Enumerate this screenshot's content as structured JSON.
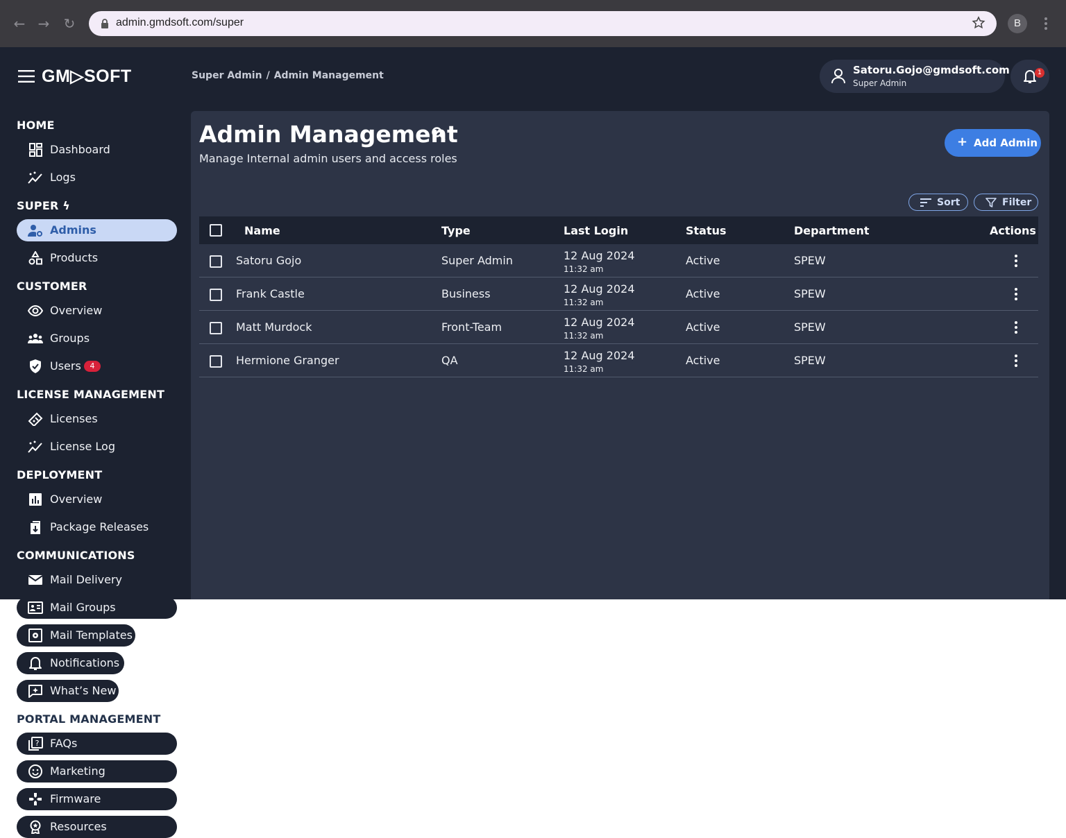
{
  "browser": {
    "url": "admin.gmdsoft.com/super",
    "profile_initial": "B"
  },
  "header": {
    "logo": "GM▷SOFT",
    "breadcrumb": [
      "Super Admin",
      "Admin Management"
    ],
    "user_email": "Satoru.Gojo@gmdsoft.com",
    "user_role": "Super Admin",
    "notification_count": "1"
  },
  "sidebar": {
    "sections": {
      "home": "HOME",
      "super": "SUPER",
      "customer": "CUSTOMER",
      "license": "LICENSE MANAGEMENT",
      "deployment": "DEPLOYMENT",
      "communications": "COMMUNICATIONS",
      "portal": "PORTAL MANAGEMENT"
    },
    "items": {
      "dashboard": "Dashboard",
      "logs": "Logs",
      "admins": "Admins",
      "products": "Products",
      "overview": "Overview",
      "groups": "Groups",
      "users": "Users",
      "users_badge": "4",
      "licenses": "Licenses",
      "license_log": "License Log",
      "deploy_overview": "Overview",
      "package_releases": "Package Releases",
      "mail_delivery": "Mail Delivery",
      "mail_groups": "Mail Groups",
      "mail_templates": "Mail Templates",
      "notifications": "Notifications",
      "whats_new": "What’s New",
      "faqs": "FAQs",
      "marketing": "Marketing",
      "firmware": "Firmware",
      "resources": "Resources"
    }
  },
  "main": {
    "title": "Admin Management",
    "subtitle": "Manage Internal admin users and access roles",
    "add_button": "Add Admin",
    "sort_label": "Sort",
    "filter_label": "Filter",
    "columns": {
      "name": "Name",
      "type": "Type",
      "last_login": "Last Login",
      "status": "Status",
      "department": "Department",
      "actions": "Actions"
    },
    "rows": [
      {
        "name": "Satoru Gojo",
        "type": "Super Admin",
        "date": "12 Aug 2024",
        "time": "11:32 am",
        "status": "Active",
        "department": "SPEW"
      },
      {
        "name": "Frank Castle",
        "type": "Business",
        "date": "12 Aug 2024",
        "time": "11:32 am",
        "status": "Active",
        "department": "SPEW"
      },
      {
        "name": "Matt Murdock",
        "type": "Front-Team",
        "date": "12 Aug 2024",
        "time": "11:32 am",
        "status": "Active",
        "department": "SPEW"
      },
      {
        "name": "Hermione Granger",
        "type": "QA",
        "date": "12 Aug 2024",
        "time": "11:32 am",
        "status": "Active",
        "department": "SPEW"
      }
    ]
  },
  "colors": {
    "app_bg": "#1c2230",
    "panel_bg": "#2d3446",
    "accent": "#3d7ee3",
    "active_nav_bg": "#c9d8f5",
    "badge": "#d8213a"
  }
}
